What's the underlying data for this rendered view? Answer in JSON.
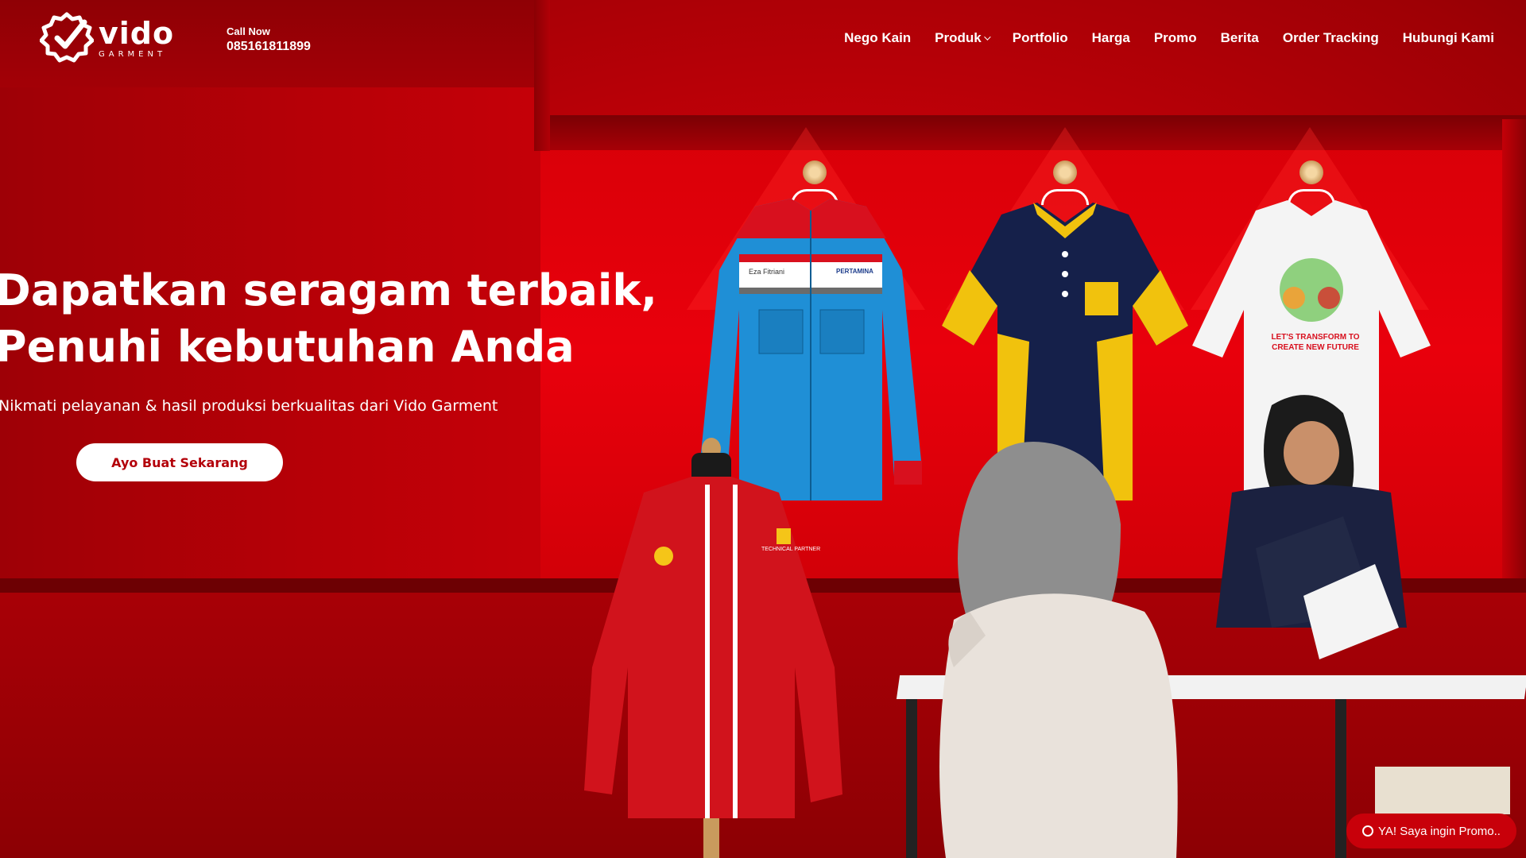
{
  "brand": {
    "name": "vido",
    "tagline": "GARMENT"
  },
  "contact": {
    "label": "Call Now",
    "phone": "085161811899"
  },
  "nav": {
    "items": [
      {
        "label": "Nego Kain",
        "dropdown": false
      },
      {
        "label": "Produk",
        "dropdown": true
      },
      {
        "label": "Portfolio",
        "dropdown": false
      },
      {
        "label": "Harga",
        "dropdown": false
      },
      {
        "label": "Promo",
        "dropdown": false
      },
      {
        "label": "Berita",
        "dropdown": false
      },
      {
        "label": "Order Tracking",
        "dropdown": false
      },
      {
        "label": "Hubungi Kami",
        "dropdown": false
      }
    ]
  },
  "hero": {
    "headline_line1": "Dapatkan seragam terbaik,",
    "headline_line2": "Penuhi kebutuhan Anda",
    "subtitle": "Nikmati pelayanan & hasil produksi berkualitas dari Vido Garment",
    "cta_label": "Ayo Buat Sekarang"
  },
  "garment_labels": {
    "work_shirt_name": "Eza Fitriani",
    "work_shirt_brand": "PERTAMINA",
    "tshirt_print": "LET'S TRANSFORM TO CREATE NEW FUTURE",
    "jacket_text": "TECHNICAL PARTNER"
  },
  "floating": {
    "whatsapp_label": "YA! Saya ingin Promo.."
  },
  "colors": {
    "primary": "#c8000a",
    "text_light": "#ffffff",
    "cta_text": "#b3000a"
  }
}
